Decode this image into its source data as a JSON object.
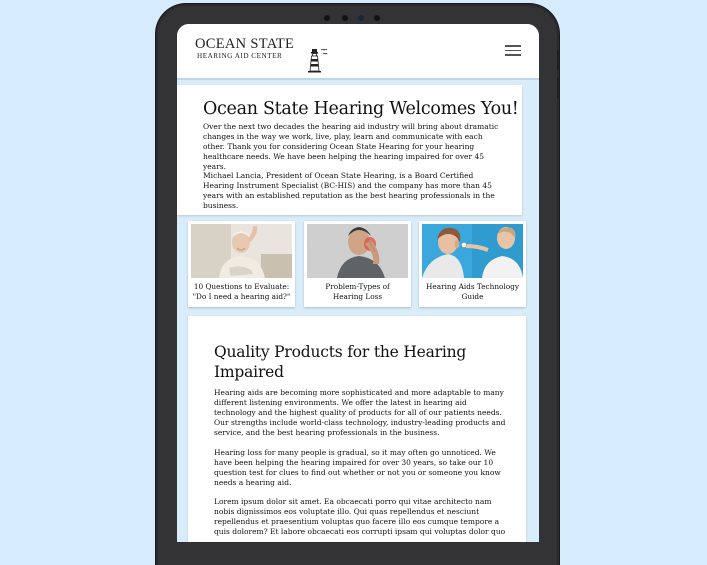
{
  "header": {
    "logo_line1": "OCEAN STATE",
    "logo_line2": "HEARING AID CENTER",
    "menu_icon": "hamburger-menu-icon"
  },
  "welcome": {
    "title": "Ocean State Hearing Welcomes You!",
    "paragraph1": "Over the next two decades the hearing aid industry will bring about dramatic changes in the way we work, live, play, learn and communicate with each other. Thank you for considering Ocean State Hearing for your hearing healthcare needs. We have been helping the hearing impaired for over 45 years.",
    "paragraph2": "Michael Lancia, President of Ocean State Hearing, is a Board Certified Hearing Instrument Specialist (BC-HIS) and the company has more than 45 years with an established reputation as the best hearing professionals in the business."
  },
  "tiles": [
    {
      "caption_line1": "10 Questions to Evaluate:",
      "caption_line2": "\"Do I need a hearing aid?\""
    },
    {
      "caption_line1": "Problem-Types of",
      "caption_line2": "Hearing Loss"
    },
    {
      "caption_line1": "Hearing Aids Technology",
      "caption_line2": "Guide"
    }
  ],
  "products": {
    "title": "Quality Products for the Hearing Impaired",
    "paragraph1": "Hearing aids are becoming more sophisticated and more adaptable to many different listening environments. We offer the latest in hearing aid technology and the highest quality of products for all of our patients needs. Our strengths include world-class technology, industry-leading products and service, and the best hearing professionals in the business.",
    "paragraph2": "Hearing loss for many people is gradual, so it may often go unnoticed. We have been helping the hearing impaired for over 30 years, so take our 10 question test for clues to find out whether or not you or someone you know needs a hearing aid.",
    "paragraph3": "Lorem ipsum dolor sit amet. Ea obcaecati porro qui vitae architecto nam nobis dignissimos eos voluptate illo. Qui quas repellendus et nesciunt repellendus et praesentium voluptas quo facere illo eos cumque tempore a quis dolorem? Et labore obcaecati eos corrupti ipsam qui voluptas dolor quo"
  },
  "colors": {
    "background": "#d6ebfb",
    "screen_background": "#d9ecf9",
    "tablet_frame": "#2a2a2c",
    "text": "#111111"
  }
}
